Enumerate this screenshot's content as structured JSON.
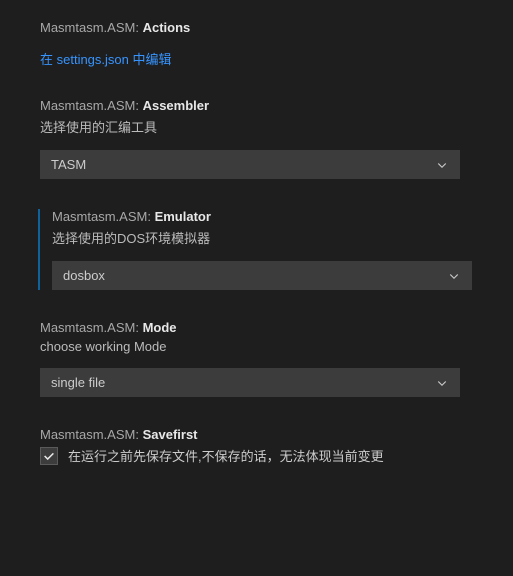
{
  "settings": {
    "actions": {
      "prefix": "Masmtasm.ASM: ",
      "name": "Actions",
      "link": "在 settings.json 中编辑"
    },
    "assembler": {
      "prefix": "Masmtasm.ASM: ",
      "name": "Assembler",
      "desc": "选择使用的汇编工具",
      "value": "TASM"
    },
    "emulator": {
      "prefix": "Masmtasm.ASM: ",
      "name": "Emulator",
      "desc": "选择使用的DOS环境模拟器",
      "value": "dosbox"
    },
    "mode": {
      "prefix": "Masmtasm.ASM: ",
      "name": "Mode",
      "desc": "choose working Mode",
      "value": "single file"
    },
    "savefirst": {
      "prefix": "Masmtasm.ASM: ",
      "name": "Savefirst",
      "checked": true,
      "label": "在运行之前先保存文件,不保存的话，无法体现当前变更"
    }
  }
}
